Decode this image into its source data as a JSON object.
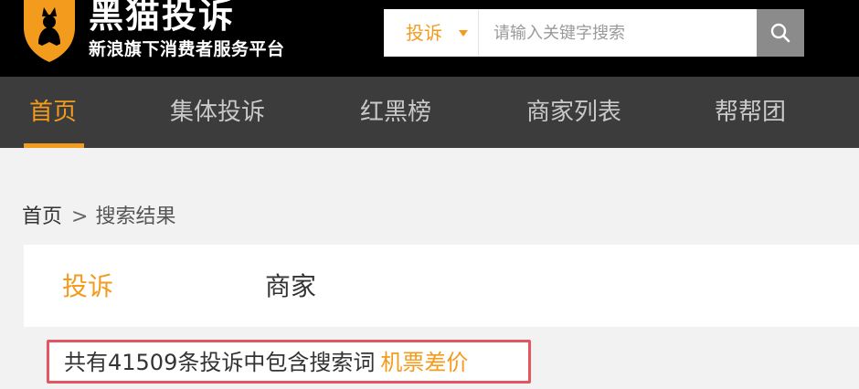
{
  "brand": {
    "title": "黑猫投诉",
    "subtitle": "新浪旗下消费者服务平台",
    "logo_icon": "cat-shield-icon"
  },
  "search": {
    "type_label": "投诉",
    "placeholder": "请输入关键字搜索",
    "value": "",
    "button_icon": "search-icon"
  },
  "nav": {
    "items": [
      {
        "label": "首页",
        "active": true
      },
      {
        "label": "集体投诉"
      },
      {
        "label": "红黑榜"
      },
      {
        "label": "商家列表"
      },
      {
        "label": "帮帮团"
      }
    ]
  },
  "breadcrumb": {
    "home": "首页",
    "separator": ">",
    "current": "搜索结果"
  },
  "tabs": {
    "complaints": "投诉",
    "merchants": "商家"
  },
  "result": {
    "summary": "共有41509条投诉中包含搜索词",
    "keyword": "机票差价"
  },
  "colors": {
    "accent": "#f39b1d",
    "header_bg": "#000000",
    "nav_bg": "#3c3c3c",
    "highlight_border": "#e4555f"
  }
}
